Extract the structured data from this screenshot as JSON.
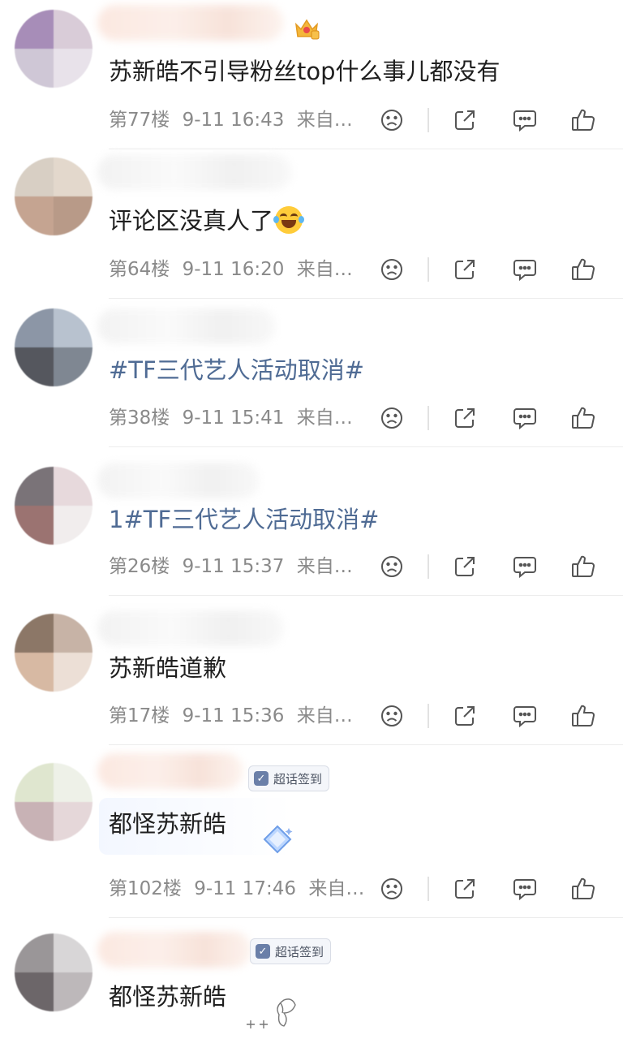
{
  "actions": {
    "icons": [
      "sad-face-icon",
      "share-icon",
      "comment-icon",
      "like-icon"
    ]
  },
  "badge_label": "超话签到",
  "comments": [
    {
      "text": "苏新皓不引导粉丝top什么事儿都没有",
      "floor": "第77楼",
      "time": "9-11 16:43",
      "source": "来自…"
    },
    {
      "text": "评论区没真人了",
      "floor": "第64楼",
      "time": "9-11 16:20",
      "source": "来自…"
    },
    {
      "text": "#TF三代艺人活动取消#",
      "floor": "第38楼",
      "time": "9-11 15:41",
      "source": "来自…"
    },
    {
      "text": "1#TF三代艺人活动取消#",
      "floor": "第26楼",
      "time": "9-11 15:37",
      "source": "来自…"
    },
    {
      "text": "苏新皓道歉",
      "floor": "第17楼",
      "time": "9-11 15:36",
      "source": "来自…"
    },
    {
      "text": "都怪苏新皓",
      "floor": "第102楼",
      "time": "9-11 17:46",
      "source": "来自…"
    },
    {
      "text": "都怪苏新皓"
    }
  ],
  "colors": {
    "topic_link": "#4f6b94",
    "meta_text": "#8a8a8a",
    "icon_stroke": "#555555"
  }
}
